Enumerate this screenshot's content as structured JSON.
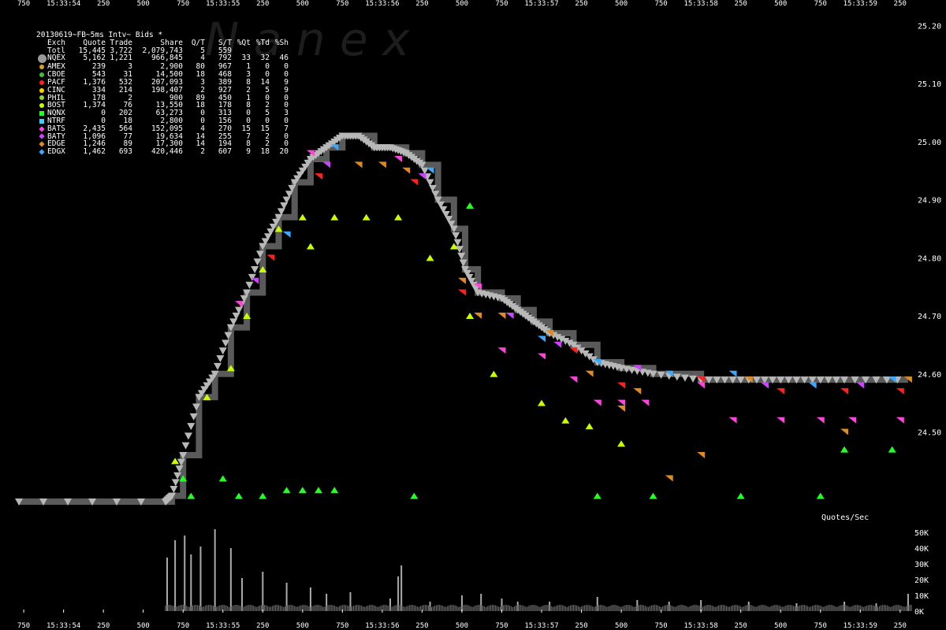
{
  "legend": {
    "title": "20130619~FB~5ms Intv~ Bids *",
    "header": [
      "Exch",
      "Quote",
      "Trade",
      "Share",
      "Q/T",
      "S/T",
      "%Qt",
      "%Td",
      "%Sh"
    ],
    "rows": [
      {
        "exch": "Totl",
        "quote": "15,445",
        "trade": "3,722",
        "share": "2,079,743",
        "qt": "5",
        "st": "559",
        "pqt": "",
        "ptd": "",
        "psh": "",
        "color": "",
        "marker": "none"
      },
      {
        "exch": "NQEX",
        "quote": "5,162",
        "trade": "1,221",
        "share": "966,845",
        "qt": "4",
        "st": "792",
        "pqt": "33",
        "ptd": "32",
        "psh": "46",
        "color": "#9a9a9a",
        "marker": "big"
      },
      {
        "exch": "AMEX",
        "quote": "239",
        "trade": "3",
        "share": "2,900",
        "qt": "80",
        "st": "967",
        "pqt": "1",
        "ptd": "0",
        "psh": "0",
        "color": "#d4a028",
        "marker": "circle"
      },
      {
        "exch": "CBOE",
        "quote": "543",
        "trade": "31",
        "share": "14,500",
        "qt": "18",
        "st": "468",
        "pqt": "3",
        "ptd": "0",
        "psh": "0",
        "color": "#3fbf3f",
        "marker": "circle"
      },
      {
        "exch": "PACF",
        "quote": "1,376",
        "trade": "532",
        "share": "207,093",
        "qt": "3",
        "st": "389",
        "pqt": "8",
        "ptd": "14",
        "psh": "9",
        "color": "#ff2020",
        "marker": "circle"
      },
      {
        "exch": "CINC",
        "quote": "334",
        "trade": "214",
        "share": "198,407",
        "qt": "2",
        "st": "927",
        "pqt": "2",
        "ptd": "5",
        "psh": "9",
        "color": "#ffd000",
        "marker": "circle"
      },
      {
        "exch": "PHIL",
        "quote": "178",
        "trade": "2",
        "share": "900",
        "qt": "89",
        "st": "450",
        "pqt": "1",
        "ptd": "0",
        "psh": "0",
        "color": "#8fd63a",
        "marker": "circle"
      },
      {
        "exch": "BOST",
        "quote": "1,374",
        "trade": "76",
        "share": "13,550",
        "qt": "18",
        "st": "178",
        "pqt": "8",
        "ptd": "2",
        "psh": "0",
        "color": "#c8ff00",
        "marker": "circle"
      },
      {
        "exch": "NQNX",
        "quote": "0",
        "trade": "202",
        "share": "63,273",
        "qt": "0",
        "st": "313",
        "pqt": "0",
        "ptd": "5",
        "psh": "3",
        "color": "#22ff22",
        "marker": "square"
      },
      {
        "exch": "NTRF",
        "quote": "0",
        "trade": "18",
        "share": "2,800",
        "qt": "0",
        "st": "156",
        "pqt": "0",
        "ptd": "0",
        "psh": "0",
        "color": "#44ccff",
        "marker": "square"
      },
      {
        "exch": "BATS",
        "quote": "2,435",
        "trade": "564",
        "share": "152,095",
        "qt": "4",
        "st": "270",
        "pqt": "15",
        "ptd": "15",
        "psh": "7",
        "color": "#ff44dd",
        "marker": "diamond"
      },
      {
        "exch": "BATY",
        "quote": "1,096",
        "trade": "77",
        "share": "19,634",
        "qt": "14",
        "st": "255",
        "pqt": "7",
        "ptd": "2",
        "psh": "0",
        "color": "#cc44ff",
        "marker": "diamond"
      },
      {
        "exch": "EDGE",
        "quote": "1,246",
        "trade": "89",
        "share": "17,300",
        "qt": "14",
        "st": "194",
        "pqt": "8",
        "ptd": "2",
        "psh": "0",
        "color": "#e08a20",
        "marker": "diamond"
      },
      {
        "exch": "EDGX",
        "quote": "1,462",
        "trade": "693",
        "share": "420,446",
        "qt": "2",
        "st": "607",
        "pqt": "9",
        "ptd": "18",
        "psh": "20",
        "color": "#3aaaff",
        "marker": "diamond"
      }
    ]
  },
  "watermark": "N a n e x",
  "volume_label": "Quotes/Sec",
  "chart_data": {
    "type": "scatter",
    "price_axis": {
      "ylim": [
        24.365,
        25.225
      ],
      "ticks": [
        24.5,
        24.6,
        24.7,
        24.8,
        24.9,
        25.0,
        25.1,
        25.2
      ],
      "tick_labels": [
        "24.50",
        "24.60",
        "24.70",
        "24.80",
        "24.90",
        "25.00",
        "25.10",
        "25.20"
      ]
    },
    "time_axis": {
      "xlim": [
        "15:33:53.700",
        "15:33:59.340"
      ],
      "ticks": [
        {
          "t": 53.75,
          "label": "750"
        },
        {
          "t": 54.0,
          "label": "15:33:54"
        },
        {
          "t": 54.25,
          "label": "250"
        },
        {
          "t": 54.5,
          "label": "500"
        },
        {
          "t": 54.75,
          "label": "750"
        },
        {
          "t": 55.0,
          "label": "15:33:55"
        },
        {
          "t": 55.25,
          "label": "250"
        },
        {
          "t": 55.5,
          "label": "500"
        },
        {
          "t": 55.75,
          "label": "750"
        },
        {
          "t": 56.0,
          "label": "15:33:56"
        },
        {
          "t": 56.25,
          "label": "250"
        },
        {
          "t": 56.5,
          "label": "500"
        },
        {
          "t": 56.75,
          "label": "750"
        },
        {
          "t": 57.0,
          "label": "15:33:57"
        },
        {
          "t": 57.25,
          "label": "250"
        },
        {
          "t": 57.5,
          "label": "500"
        },
        {
          "t": 57.75,
          "label": "750"
        },
        {
          "t": 58.0,
          "label": "15:33:58"
        },
        {
          "t": 58.25,
          "label": "250"
        },
        {
          "t": 58.5,
          "label": "500"
        },
        {
          "t": 58.75,
          "label": "750"
        },
        {
          "t": 59.0,
          "label": "15:33:59"
        },
        {
          "t": 59.25,
          "label": "250"
        }
      ]
    },
    "volume_axis": {
      "ylim": [
        0,
        55000
      ],
      "ticks": [
        0,
        10000,
        20000,
        30000,
        40000,
        50000
      ],
      "tick_labels": [
        "0K",
        "10K",
        "20K",
        "30K",
        "40K",
        "50K"
      ]
    },
    "nbb_path": [
      [
        53.72,
        24.38
      ],
      [
        54.64,
        24.38
      ],
      [
        54.68,
        24.39
      ],
      [
        54.75,
        24.46
      ],
      [
        54.85,
        24.56
      ],
      [
        54.95,
        24.6
      ],
      [
        55.05,
        24.68
      ],
      [
        55.15,
        24.74
      ],
      [
        55.25,
        24.82
      ],
      [
        55.35,
        24.87
      ],
      [
        55.45,
        24.93
      ],
      [
        55.55,
        24.97
      ],
      [
        55.65,
        24.99
      ],
      [
        55.75,
        25.01
      ],
      [
        55.85,
        25.01
      ],
      [
        55.95,
        24.99
      ],
      [
        56.05,
        24.99
      ],
      [
        56.15,
        24.98
      ],
      [
        56.25,
        24.96
      ],
      [
        56.35,
        24.9
      ],
      [
        56.45,
        24.85
      ],
      [
        56.52,
        24.78
      ],
      [
        56.6,
        24.74
      ],
      [
        56.75,
        24.73
      ],
      [
        56.85,
        24.71
      ],
      [
        56.95,
        24.69
      ],
      [
        57.05,
        24.67
      ],
      [
        57.2,
        24.65
      ],
      [
        57.35,
        24.62
      ],
      [
        57.5,
        24.61
      ],
      [
        57.7,
        24.6
      ],
      [
        58.0,
        24.59
      ],
      [
        58.3,
        24.59
      ],
      [
        58.6,
        24.59
      ],
      [
        58.9,
        24.59
      ],
      [
        59.3,
        24.59
      ]
    ],
    "quote_series": [
      {
        "exch": "BOST",
        "color": "#c8ff00",
        "points": [
          [
            54.7,
            24.45
          ],
          [
            54.9,
            24.56
          ],
          [
            55.05,
            24.61
          ],
          [
            55.15,
            24.7
          ],
          [
            55.25,
            24.78
          ],
          [
            55.35,
            24.85
          ],
          [
            55.5,
            24.87
          ],
          [
            55.55,
            24.82
          ],
          [
            55.7,
            24.87
          ],
          [
            55.9,
            24.87
          ],
          [
            56.1,
            24.87
          ],
          [
            56.3,
            24.8
          ],
          [
            56.45,
            24.82
          ],
          [
            56.55,
            24.7
          ],
          [
            56.7,
            24.6
          ],
          [
            57.0,
            24.55
          ],
          [
            57.15,
            24.52
          ],
          [
            57.3,
            24.51
          ],
          [
            57.5,
            24.48
          ]
        ]
      },
      {
        "exch": "NQNX",
        "color": "#22ff22",
        "points": [
          [
            54.75,
            24.42
          ],
          [
            54.8,
            24.39
          ],
          [
            55.0,
            24.42
          ],
          [
            55.1,
            24.39
          ],
          [
            55.25,
            24.39
          ],
          [
            55.4,
            24.4
          ],
          [
            55.5,
            24.4
          ],
          [
            55.6,
            24.4
          ],
          [
            55.7,
            24.4
          ],
          [
            56.2,
            24.39
          ],
          [
            56.55,
            24.89
          ],
          [
            57.35,
            24.39
          ],
          [
            57.7,
            24.39
          ],
          [
            58.25,
            24.39
          ],
          [
            58.75,
            24.39
          ],
          [
            58.9,
            24.47
          ],
          [
            59.2,
            24.47
          ]
        ]
      },
      {
        "exch": "BATS",
        "color": "#ff44dd",
        "points": [
          [
            55.1,
            24.72
          ],
          [
            55.55,
            24.98
          ],
          [
            56.1,
            24.97
          ],
          [
            56.6,
            24.75
          ],
          [
            56.75,
            24.64
          ],
          [
            57.0,
            24.63
          ],
          [
            57.2,
            24.59
          ],
          [
            57.35,
            24.55
          ],
          [
            57.5,
            24.55
          ],
          [
            57.65,
            24.55
          ],
          [
            58.0,
            24.58
          ],
          [
            58.2,
            24.52
          ],
          [
            58.5,
            24.52
          ],
          [
            58.75,
            24.52
          ],
          [
            58.95,
            24.52
          ],
          [
            59.25,
            24.52
          ]
        ]
      },
      {
        "exch": "EDGE",
        "color": "#e08a20",
        "points": [
          [
            55.85,
            24.96
          ],
          [
            56.0,
            24.96
          ],
          [
            56.15,
            24.95
          ],
          [
            56.5,
            24.76
          ],
          [
            56.6,
            24.7
          ],
          [
            56.75,
            24.7
          ],
          [
            57.05,
            24.67
          ],
          [
            57.3,
            24.6
          ],
          [
            57.5,
            24.54
          ],
          [
            57.6,
            24.57
          ],
          [
            57.8,
            24.42
          ],
          [
            58.0,
            24.46
          ],
          [
            58.3,
            24.59
          ],
          [
            58.9,
            24.5
          ],
          [
            59.3,
            24.59
          ]
        ]
      },
      {
        "exch": "PACF",
        "color": "#ff2020",
        "points": [
          [
            55.3,
            24.8
          ],
          [
            55.6,
            24.94
          ],
          [
            56.2,
            24.93
          ],
          [
            56.5,
            24.74
          ],
          [
            57.2,
            24.64
          ],
          [
            57.5,
            24.58
          ],
          [
            58.0,
            24.59
          ],
          [
            58.5,
            24.57
          ],
          [
            58.9,
            24.57
          ],
          [
            59.25,
            24.57
          ]
        ]
      },
      {
        "exch": "EDGX",
        "color": "#3aaaff",
        "points": [
          [
            55.4,
            24.84
          ],
          [
            55.7,
            24.99
          ],
          [
            56.3,
            24.95
          ],
          [
            57.0,
            24.66
          ],
          [
            57.35,
            24.62
          ],
          [
            57.8,
            24.6
          ],
          [
            58.2,
            24.6
          ],
          [
            58.7,
            24.58
          ],
          [
            59.2,
            24.59
          ]
        ]
      },
      {
        "exch": "BATY",
        "color": "#cc44ff",
        "points": [
          [
            55.2,
            24.76
          ],
          [
            55.65,
            24.96
          ],
          [
            56.25,
            24.94
          ],
          [
            56.8,
            24.7
          ],
          [
            57.1,
            24.65
          ],
          [
            57.6,
            24.61
          ],
          [
            58.4,
            24.58
          ],
          [
            59.0,
            24.58
          ]
        ]
      }
    ],
    "volume_spikes": [
      [
        54.65,
        34000
      ],
      [
        54.7,
        45000
      ],
      [
        54.76,
        48000
      ],
      [
        54.8,
        36000
      ],
      [
        54.86,
        41000
      ],
      [
        54.95,
        52000
      ],
      [
        55.05,
        40000
      ],
      [
        55.12,
        21000
      ],
      [
        55.25,
        25000
      ],
      [
        55.4,
        18000
      ],
      [
        55.55,
        15000
      ],
      [
        55.65,
        11000
      ],
      [
        55.8,
        12000
      ],
      [
        56.05,
        8000
      ],
      [
        56.1,
        22000
      ],
      [
        56.12,
        29000
      ],
      [
        56.3,
        6000
      ],
      [
        56.5,
        10000
      ],
      [
        56.62,
        11000
      ],
      [
        56.75,
        8000
      ],
      [
        56.85,
        6000
      ],
      [
        57.05,
        6000
      ],
      [
        57.35,
        9000
      ],
      [
        57.6,
        7000
      ],
      [
        57.8,
        6000
      ],
      [
        58.0,
        7000
      ],
      [
        58.3,
        6000
      ],
      [
        58.6,
        5000
      ],
      [
        58.9,
        6000
      ],
      [
        59.1,
        5000
      ],
      [
        59.3,
        11000
      ]
    ]
  }
}
